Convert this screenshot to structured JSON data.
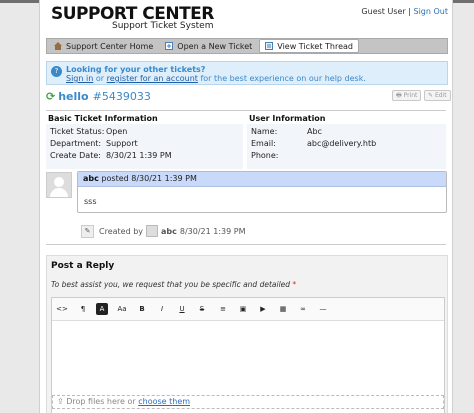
{
  "header": {
    "title": "SUPPORT CENTER",
    "subtitle": "Support Ticket System",
    "guest_user": "Guest User",
    "separator": "|",
    "sign_in": "Sign Out"
  },
  "nav": [
    {
      "label": "Support Center Home",
      "icon": "home-icon"
    },
    {
      "label": "Open a New Ticket",
      "icon": "new-ticket-icon"
    },
    {
      "label": "View Ticket Thread",
      "icon": "thread-icon"
    }
  ],
  "notice": {
    "heading": "Looking for your other tickets?",
    "sign_in_link": "Sign in",
    "or": "or",
    "register_link": "register for an account",
    "rest": "for the best experience on our help desk."
  },
  "ticket": {
    "subject": "hello",
    "number": "#5439033",
    "print_label": "Print",
    "edit_label": "Edit"
  },
  "basic_info": {
    "heading": "Basic Ticket Information",
    "status_label": "Ticket Status:",
    "status_value": "Open",
    "department_label": "Department:",
    "department_value": "Support",
    "created_label": "Create Date:",
    "created_value": "8/30/21 1:39 PM"
  },
  "user_info": {
    "heading": "User Information",
    "name_label": "Name:",
    "name_value": "Abc",
    "email_label": "Email:",
    "email_value": "abc@delivery.htb",
    "phone_label": "Phone:",
    "phone_value": ""
  },
  "thread": {
    "author": "abc",
    "posted_text": "posted 8/30/21 1:39 PM",
    "body": "sss",
    "event_created_by": "Created by",
    "event_author": "abc",
    "event_time": "8/30/21 1:39 PM"
  },
  "reply": {
    "title": "Post a Reply",
    "description": "To best assist you, we request that you be specific and detailed",
    "required_mark": "*",
    "dropzone_text": "Drop files here or",
    "dropzone_link": "choose them"
  },
  "toolbar": {
    "buttons": [
      {
        "name": "code-view-button",
        "glyph": "<>"
      },
      {
        "name": "paragraph-button",
        "glyph": "¶"
      },
      {
        "name": "text-color-button",
        "glyph": "A"
      },
      {
        "name": "font-size-button",
        "glyph": "Aa"
      },
      {
        "name": "bold-button",
        "glyph": "B"
      },
      {
        "name": "italic-button",
        "glyph": "I"
      },
      {
        "name": "underline-button",
        "glyph": "U"
      },
      {
        "name": "strikethrough-button",
        "glyph": "S"
      },
      {
        "name": "list-button",
        "glyph": "≡"
      },
      {
        "name": "image-button",
        "glyph": "▣"
      },
      {
        "name": "video-button",
        "glyph": "▶"
      },
      {
        "name": "table-button",
        "glyph": "▦"
      },
      {
        "name": "link-button",
        "glyph": "∞"
      },
      {
        "name": "horizontal-rule-button",
        "glyph": "—"
      }
    ]
  },
  "colors": {
    "accent": "#3a89c9",
    "link": "#2a6ebb",
    "entry_header": "#c8d9fa",
    "notice_bg": "#dfeefb"
  }
}
